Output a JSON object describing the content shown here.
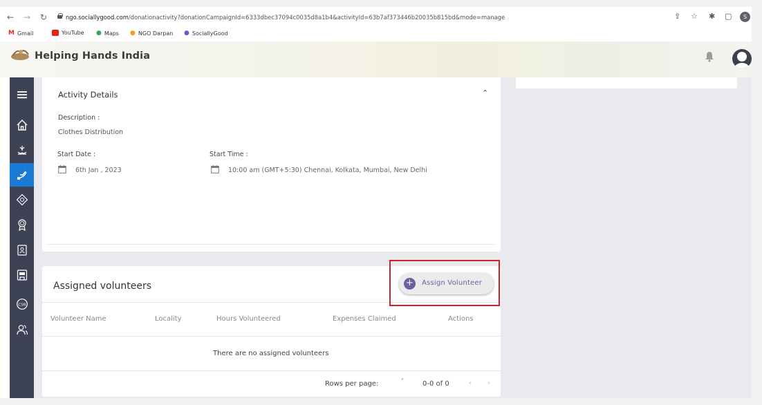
{
  "browser": {
    "url_domain": "ngo.sociallygood.com",
    "url_rest": "/donationactivity?donationCampaignId=6333dbec37094c0035d8a1b4&activityId=63b7af373446b20035b815bd&mode=manage",
    "profile_letter": "S",
    "bookmarks": [
      "Gmail",
      "YouTube",
      "Maps",
      "NGO Darpan",
      "SociallyGood"
    ]
  },
  "app": {
    "brand": "Helping Hands India"
  },
  "activity": {
    "section_title": "Activity Details",
    "description_label": "Description :",
    "description_value": "Clothes Distribution",
    "start_date_label": "Start Date :",
    "start_date_value": "6th Jan , 2023",
    "start_time_label": "Start Time :",
    "start_time_value": "10:00 am (GMT+5:30) Chennai, Kolkata, Mumbai, New Delhi"
  },
  "volunteers": {
    "title": "Assigned volunteers",
    "assign_button": "Assign Volunteer",
    "columns": [
      "Volunteer Name",
      "Locality",
      "Hours Volunteered",
      "Expenses Claimed",
      "Actions"
    ],
    "empty_message": "There are no assigned volunteers",
    "rows_per_page_label": "Rows per page:",
    "page_range": "0-0 of 0"
  },
  "colors": {
    "sidebar_bg": "#3e4255",
    "sidebar_active": "#1a7bd6",
    "accent_purple": "#6a5f9f",
    "highlight_red": "#d11f27"
  }
}
